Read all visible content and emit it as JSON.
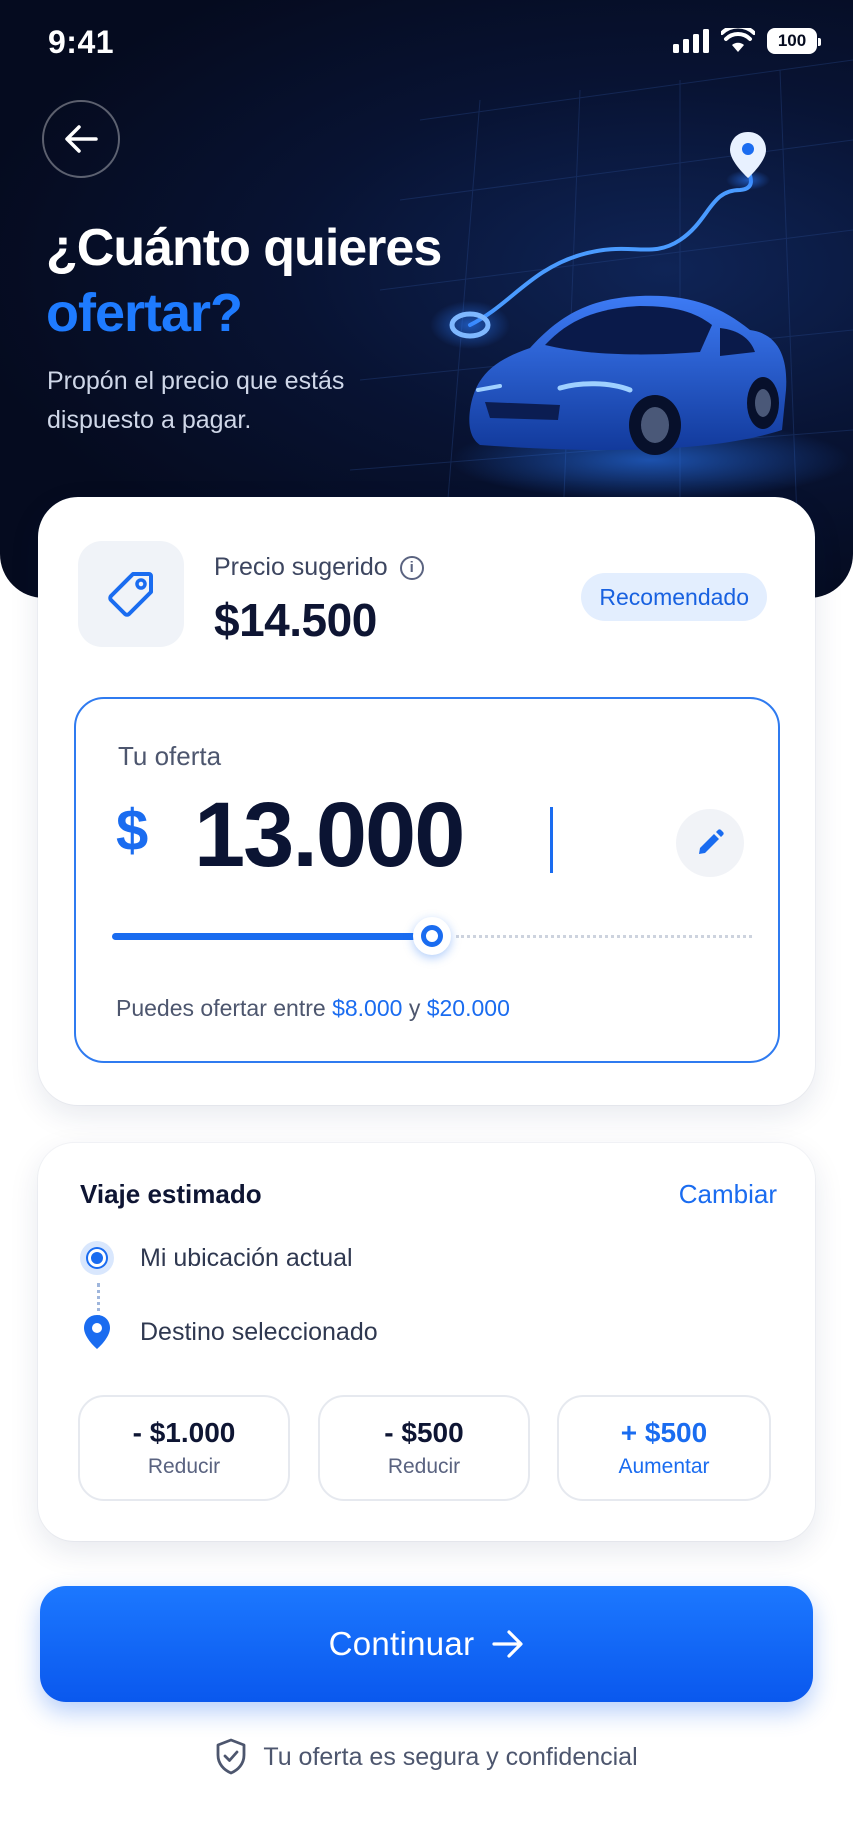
{
  "status_bar": {
    "time": "9:41",
    "battery": "100"
  },
  "header": {
    "title_line1": "¿Cuánto quieres",
    "title_line2": "ofertar?",
    "subtitle": "Propón el precio que estás dispuesto a pagar."
  },
  "suggested": {
    "label": "Precio sugerido",
    "price": "$14.500",
    "badge": "Recomendado"
  },
  "offer": {
    "label": "Tu oferta",
    "currency": "$",
    "amount": "13.000",
    "slider_fraction": 0.5,
    "range_prefix": "Puedes ofertar entre",
    "range_min": "$8.000",
    "range_joiner": "y",
    "range_max": "$20.000"
  },
  "trip": {
    "title": "Viaje estimado",
    "change_label": "Cambiar",
    "origin": "Mi ubicación actual",
    "destination": "Destino seleccionado"
  },
  "adjust_buttons": [
    {
      "amount": "- $1.000",
      "label": "Reducir"
    },
    {
      "amount": "- $500",
      "label": "Reducir"
    },
    {
      "amount": "+ $500",
      "label": "Aumentar"
    }
  ],
  "continue_label": "Continuar",
  "secure_note": "Tu oferta es segura y confidencial",
  "colors": {
    "accent": "#1a6cf0",
    "hero_bg": "#050b1f",
    "text_dark": "#0e1533"
  }
}
